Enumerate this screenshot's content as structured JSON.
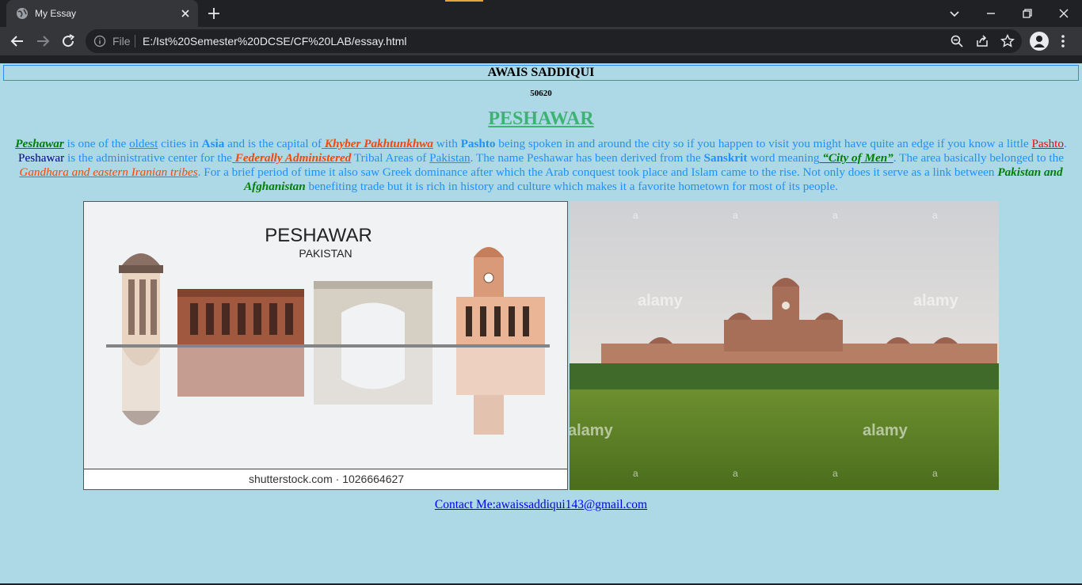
{
  "browser": {
    "tab_title": "My Essay",
    "url_scheme": "File",
    "url": "E:/Ist%20Semester%20DCSE/CF%20LAB/essay.html",
    "icons": [
      "globe-icon",
      "close-icon",
      "plus-icon",
      "chevron-down-icon",
      "minimize-icon",
      "restore-icon",
      "window-close-icon",
      "back-arrow-icon",
      "forward-arrow-icon",
      "reload-icon",
      "info-icon",
      "zoom-icon",
      "share-icon",
      "star-icon",
      "profile-icon",
      "kebab-menu-icon"
    ]
  },
  "page": {
    "author": "AWAIS SADDIQUI",
    "student_id": "50620",
    "title": "PESHAWAR",
    "essay": {
      "w1": "Peshawar",
      "t1": " is one of the ",
      "w2": "oldest",
      "t2": " cities in ",
      "w3": "Asia",
      "t3": " and is the capital of",
      "w4": " Khyber Pakhtunkhwa",
      "t4": " with ",
      "w5": "Pashto",
      "t5": " being spoken in and around the city so if you happen to visit you might have quite an edge if you know a little ",
      "w6": "Pashto",
      "t6": ". ",
      "w7": "Peshawar",
      "t7": " is the administrative center for the",
      "w8": " Federally Administered",
      "t8": " Tribal Areas of ",
      "w9": "Pakistan",
      "t9": ". The name Peshawar has been derived from the ",
      "w10": "Sanskrit",
      "t10": " word meaning",
      "w11": " “City of Men”",
      "t11": ". The area basically belonged to the ",
      "w12": "Gandhara and eastern Iranian tribes",
      "t12": ". For a brief period of time it also saw Greek dominance after which the Arab conquest took place and Islam came to the rise. Not only does it serve as a link between ",
      "w13": "Pakistan and Afghanistan",
      "t13": " benefiting trade but it is rich in history and culture which makes it a favorite hometown for most of its people."
    },
    "image_left": {
      "heading": "PESHAWAR",
      "subheading": "PAKISTAN",
      "caption": "shutterstock.com · 1026664627"
    },
    "image_right": {
      "watermark": "alamy",
      "watermark_letter": "a"
    },
    "contact": "Contact Me:awaissaddiqui143@gmail.com"
  },
  "colors": {
    "page_background": "#add8e6",
    "title_green": "#3cb371",
    "essay_blue": "#1e90ff",
    "accent_green": "#008000",
    "accent_orange": "#ff4500",
    "link_blue": "#0000ee"
  }
}
